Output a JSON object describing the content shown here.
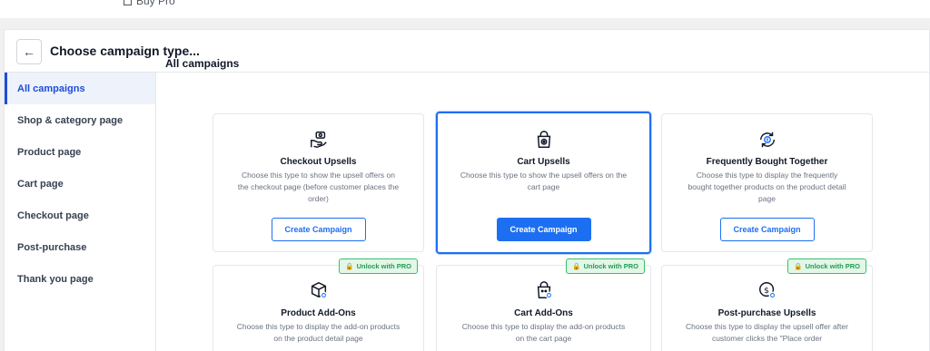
{
  "topbar": {
    "buy_pro": "Buy Pro"
  },
  "header": {
    "back_icon": "arrow-left-icon",
    "title": "Choose campaign type..."
  },
  "sidebar": {
    "items": [
      {
        "label": "All campaigns",
        "active": true
      },
      {
        "label": "Shop & category page"
      },
      {
        "label": "Product page"
      },
      {
        "label": "Cart page"
      },
      {
        "label": "Checkout page"
      },
      {
        "label": "Post-purchase"
      },
      {
        "label": "Thank you page"
      }
    ]
  },
  "main": {
    "section_title": "All campaigns",
    "cards": [
      {
        "icon": "hand-coin-icon",
        "title": "Checkout Upsells",
        "desc": "Choose this type to show the upsell offers on the checkout page (before customer places the order)",
        "button": "Create Campaign"
      },
      {
        "icon": "shopping-bag-coin-icon",
        "title": "Cart Upsells",
        "desc": "Choose this type to show the upsell offers on the cart page",
        "button": "Create Campaign",
        "selected": true
      },
      {
        "icon": "refresh-coin-icon",
        "title": "Frequently Bought Together",
        "desc": "Choose this type to display the frequently bought together products on the product detail page",
        "button": "Create Campaign"
      },
      {
        "icon": "box-plus-icon",
        "title": "Product Add-Ons",
        "desc": "Choose this type to display the add-on products on the product detail page",
        "badge": "Unlock with PRO"
      },
      {
        "icon": "cart-plus-icon",
        "title": "Cart Add-Ons",
        "desc": "Choose this type to display the add-on products on the cart page",
        "badge": "Unlock with PRO"
      },
      {
        "icon": "dollar-plus-icon",
        "title": "Post-purchase Upsells",
        "desc": "Choose this type to display the upsell offer after customer clicks the \"Place order",
        "badge": "Unlock with PRO"
      }
    ]
  },
  "colors": {
    "accent": "#1d6ff2",
    "pro_green": "#1f9d4f",
    "pro_bg": "#e3f7e8"
  }
}
